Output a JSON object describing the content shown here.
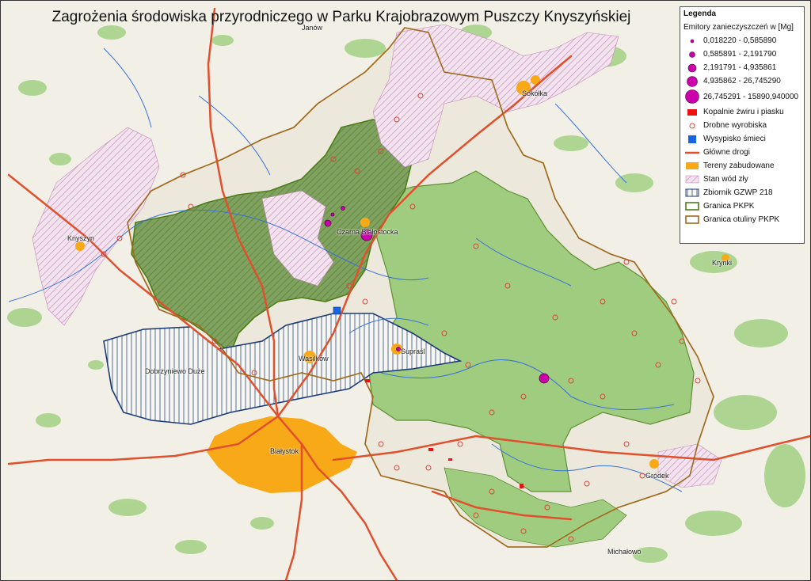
{
  "map": {
    "title": "Zagrożenia środowiska przyrodniczego w Parku Krajobrazowym Puszczy Knyszyńskiej",
    "places": [
      {
        "id": "janow",
        "name": "Janów"
      },
      {
        "id": "sokolka",
        "name": "Sokółka"
      },
      {
        "id": "knyszyn",
        "name": "Knyszyn"
      },
      {
        "id": "czarna",
        "name": "Czarna Białostocka"
      },
      {
        "id": "krynki",
        "name": "Krynki"
      },
      {
        "id": "dobrzyniewo",
        "name": "Dobrzyniewo Duże"
      },
      {
        "id": "wasilkow",
        "name": "Wasilków"
      },
      {
        "id": "suprasl",
        "name": "Supraśl"
      },
      {
        "id": "bialystok",
        "name": "Białystok"
      },
      {
        "id": "grodek",
        "name": "Gródek"
      },
      {
        "id": "michalowo",
        "name": "Michałowo"
      }
    ]
  },
  "legend": {
    "title": "Legenda",
    "emitters_heading": "Emitory zanieczyszczeń w [Mg]",
    "emitter_classes": [
      {
        "label": "0,018220 - 0,585890"
      },
      {
        "label": "0,585891 - 2,191790"
      },
      {
        "label": "2,191791 - 4,935861"
      },
      {
        "label": "4,935862 - 26,745290"
      },
      {
        "label": "26,745291 - 15890,940000"
      }
    ],
    "items": [
      {
        "id": "kopalnie",
        "label": "Kopalnie żwiru i piasku"
      },
      {
        "id": "wyrobiska",
        "label": "Drobne wyrobiska"
      },
      {
        "id": "wysypisko",
        "label": "Wysypisko śmieci"
      },
      {
        "id": "drogi",
        "label": "Główne drogi"
      },
      {
        "id": "zabudowane",
        "label": "Tereny zabudowane"
      },
      {
        "id": "wody",
        "label": "Stan wód zły"
      },
      {
        "id": "gzwp",
        "label": "Zbiornik GZWP  218"
      },
      {
        "id": "pkpk",
        "label": "Granica PKPK"
      },
      {
        "id": "otulina",
        "label": "Granica otuliny PKPK"
      }
    ]
  },
  "colors": {
    "background": "#f2efe6",
    "forest": "#9fcc7f",
    "park_green": "#8cc16a",
    "park_hatch_green": "#6f9a52",
    "hatch_pink": "#e8cde4",
    "built_up": "#f8a917",
    "roads": "#e0502d",
    "rivers": "#3a72d8",
    "emitter": "#cc00aa",
    "mine": "#ee1111",
    "landfill": "#1565e0",
    "gzwp": "#1a3a7a",
    "pkpk_border": "#4e7d18",
    "otulina_border": "#a06a1e"
  }
}
